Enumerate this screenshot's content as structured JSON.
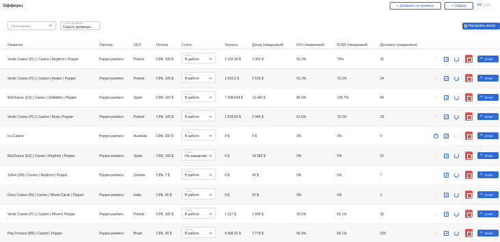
{
  "header": {
    "title": "Офферы",
    "add_from_example_label": "+ Добавить из примера",
    "add_offer_label": "+ Оффер",
    "lang_active": "РУ",
    "lang_inactive": "EN"
  },
  "filters": {
    "grouping_placeholder": "Группировка",
    "archive_label": "Статус архивации",
    "archive_value": "Скрыть архивные",
    "columns_button": "Настроить колон"
  },
  "columns": [
    "Название",
    "Партнер",
    "GEO",
    "Оплата",
    "Статус",
    "Затраты",
    "Доход (ожидаемый)",
    "ROI (ожидаемый)",
    "ROMI (ожидаемый)",
    "Депозиты (ожидаемые)"
  ],
  "status_field_label": "Статус",
  "report_label": "Отчет",
  "rows": [
    {
      "name": "Verde Casino (PL) | Casino | Regform | Pepper",
      "partner": "Pepper.partners",
      "geo": "Poland",
      "payment": "CPA, 105 $",
      "status": "В работе",
      "cost": "2 163,34 $",
      "income": "3 360 $",
      "roi": "55.3%",
      "romi": "75%",
      "deposits": "32",
      "info": false
    },
    {
      "name": "Verde Casino (PL) | Casino | Aviator | Pepper",
      "partner": "Pepper.partners",
      "geo": "Poland",
      "payment": "CPA, 105 $",
      "status": "В работе",
      "cost": "1 552,6 $",
      "income": "2 520 $",
      "roi": "62.3%",
      "romi": "72.2%",
      "deposits": "24",
      "info": false
    },
    {
      "name": "MaChance (ES) | Casino | Slotfather | Pepper",
      "partner": "Pepper.partners",
      "geo": "Spain",
      "payment": "CPA, 160 $",
      "status": "В работе",
      "cost": "7 268,604 $",
      "income": "13 440 $",
      "roi": "84.9%",
      "romi": "105.7%",
      "deposits": "84",
      "info": false
    },
    {
      "name": "Verde Casino (PL) | Casino | Book | Pepper",
      "partner": "Pepper.partners",
      "geo": "Poland",
      "payment": "CPA, 105 $",
      "status": "В работе",
      "cost": "1 818,69 $",
      "income": "2 940 $",
      "roi": "61.6%",
      "romi": "79.5%",
      "deposits": "28",
      "info": false
    },
    {
      "name": "Ice Casino",
      "partner": "Pepper.partners",
      "geo": "Australia",
      "payment": "CPA, 200 $",
      "status": "В работе",
      "cost": "0 $",
      "income": "0 $",
      "roi": "0%",
      "romi": "0%",
      "deposits": "0",
      "info": true
    },
    {
      "name": "MaChance (ES) | Casino | Regform | Pepper",
      "partner": "Pepper.partners",
      "geo": "Spain",
      "payment": "CPA, 160 $",
      "status": "На заведении",
      "cost": "0 $",
      "income": "14 560 $",
      "roi": "0%",
      "romi": "0%",
      "deposits": "91",
      "info": false
    },
    {
      "name": "1xBet (ZM) | Casino | Regform | Pepper",
      "partner": "Pepper.partners",
      "geo": "Zambia",
      "payment": "CPA, 7 $",
      "status": "В работе",
      "cost": "0 $",
      "income": "49 $",
      "roi": "0%",
      "romi": "0%",
      "deposits": "7",
      "info": false
    },
    {
      "name": "Glory Casino (IN) | Casino | Wheel Cards | Pepper",
      "partner": "Pepper.partners",
      "geo": "India",
      "payment": "CPA, 25 $",
      "status": "В работе",
      "cost": "0 $",
      "income": "50 $",
      "roi": "0%",
      "romi": "0%",
      "deposits": "2",
      "info": false
    },
    {
      "name": "Verde Casino (PL) | Casino | Wheel | Pepper",
      "partner": "Pepper.partners",
      "geo": "Poland",
      "payment": "CPA, 105 $",
      "status": "В работе",
      "cost": "1 317 $",
      "income": "1 890 $",
      "roi": "43.5%",
      "romi": "66.1%",
      "deposits": "18",
      "info": false
    },
    {
      "name": "Play Fortuna (BR) | Casino | Pepper",
      "partner": "Pepper.partners",
      "geo": "Brazil",
      "payment": "CPA, 30 $",
      "status": "В работе",
      "cost": "4 968,35 $",
      "income": "7 770 $",
      "roi": "56.4%",
      "romi": "65.1%",
      "deposits": "259",
      "info": false
    }
  ]
}
